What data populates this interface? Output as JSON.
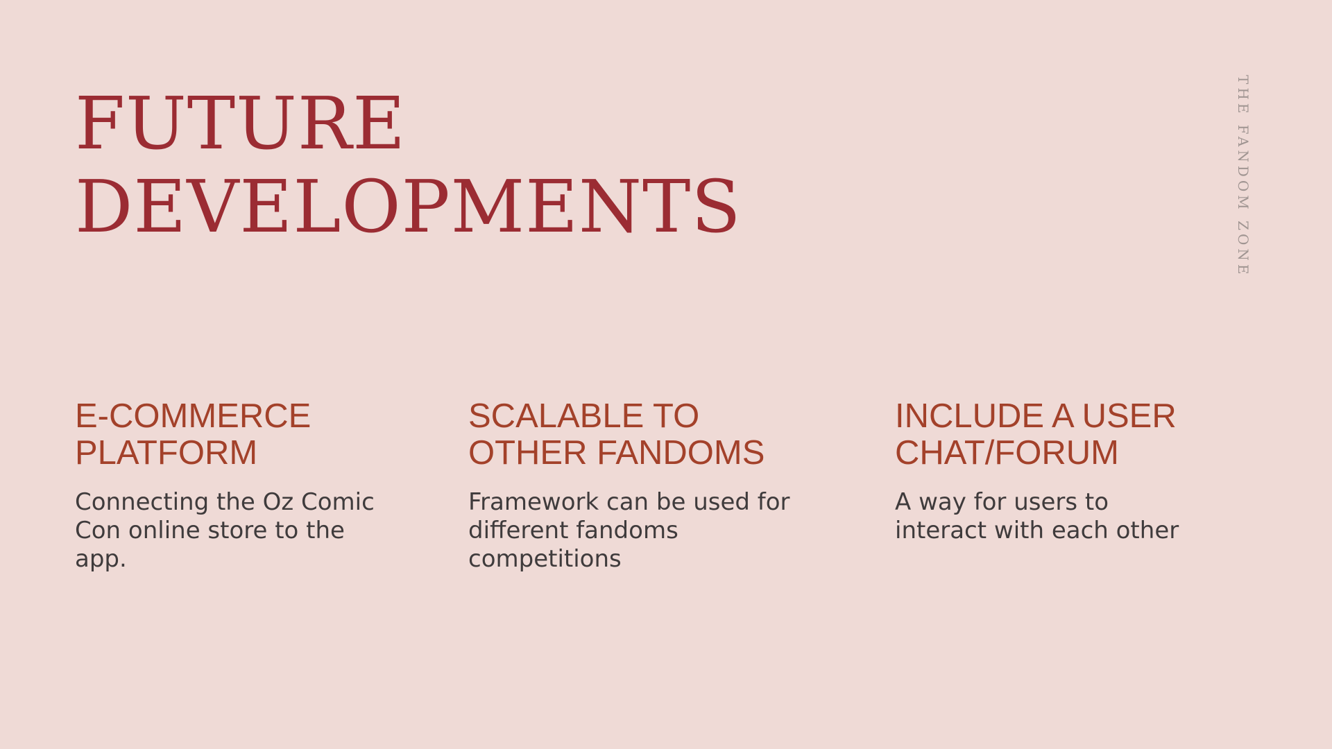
{
  "title": {
    "line1": "FUTURE",
    "line2": "DEVELOPMENTS"
  },
  "brand_text": "THE FANDOM ZONE",
  "columns": [
    {
      "heading": "E-COMMERCE\nPLATFORM",
      "body": "Connecting the Oz Comic\nCon online store to the\napp."
    },
    {
      "heading": "SCALABLE TO\nOTHER FANDOMS",
      "body": "Framework can be used for\ndifferent fandoms\ncompetitions"
    },
    {
      "heading": "INCLUDE A USER\nCHAT/FORUM",
      "body": "A way for users to\ninteract with each other"
    }
  ],
  "colors": {
    "background": "#efdad6",
    "title": "#9b2c33",
    "heading": "#a3412a",
    "body": "#3f3b3c",
    "brand": "#a09592"
  }
}
